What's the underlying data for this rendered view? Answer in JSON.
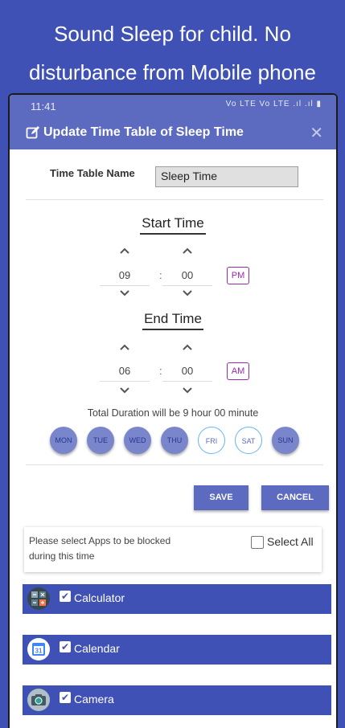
{
  "promo": {
    "line1": "Sound Sleep for child. No",
    "line2": "disturbance from Mobile phone"
  },
  "statusbar": {
    "time": "11:41",
    "icons": "Vo LTE  Vo LTE  .ıl  .ıl  ▮"
  },
  "dialog": {
    "title": "Update Time Table of Sleep Time",
    "close": "✕",
    "name_label": "Time Table Name",
    "name_value": "Sleep Time"
  },
  "start": {
    "title": "Start Time",
    "hour": "09",
    "minute": "00",
    "ampm": "PM"
  },
  "end": {
    "title": "End Time",
    "hour": "06",
    "minute": "00",
    "ampm": "AM"
  },
  "colon": ":",
  "duration": "Total Duration will be 9 hour 00 minute",
  "days": [
    {
      "label": "MON",
      "selected": true
    },
    {
      "label": "TUE",
      "selected": true
    },
    {
      "label": "WED",
      "selected": true
    },
    {
      "label": "THU",
      "selected": true
    },
    {
      "label": "FRI",
      "selected": false
    },
    {
      "label": "SAT",
      "selected": false
    },
    {
      "label": "SUN",
      "selected": true
    }
  ],
  "buttons": {
    "save": "SAVE",
    "cancel": "CANCEL"
  },
  "apps_section": {
    "instruction": "Please select Apps to be blocked during this time",
    "select_all": "Select All",
    "select_all_checked": false
  },
  "apps": [
    {
      "name": "Calculator",
      "checked": true,
      "icon": "calculator-icon"
    },
    {
      "name": "Calendar",
      "checked": true,
      "icon": "calendar-icon",
      "icon_text": "31"
    },
    {
      "name": "Camera",
      "checked": true,
      "icon": "camera-icon"
    }
  ],
  "colors": {
    "background": "#3f51b5",
    "header": "#5c6bc0",
    "day_selected": "#7986cb",
    "ampm_accent": "#9c27b0"
  }
}
